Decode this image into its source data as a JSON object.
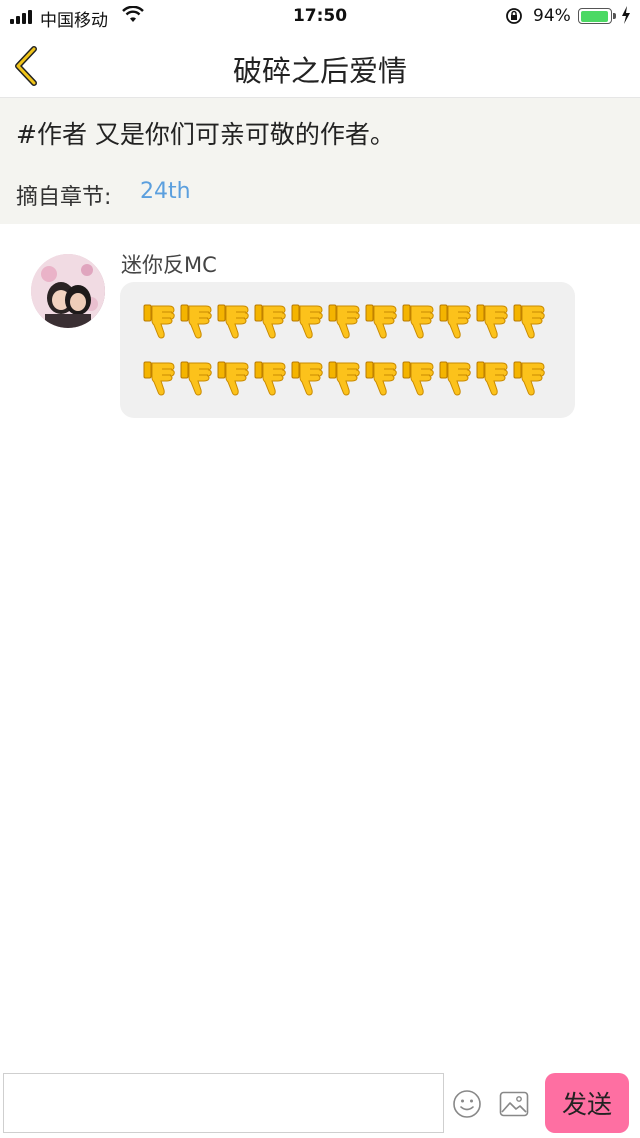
{
  "status_bar": {
    "carrier": "中国移动",
    "time": "17:50",
    "battery_percent": "94%",
    "battery_level": 0.94,
    "signal_bars": 4
  },
  "nav": {
    "title": "破碎之后爱情",
    "back_icon": "chevron-left-icon",
    "accent_color": "#f0c419"
  },
  "quote": {
    "text": "#作者 又是你们可亲可敬的作者。",
    "chapter_label": "摘自章节:",
    "chapter_value": "24th"
  },
  "comments": [
    {
      "username": "迷你反MC",
      "avatar_icon": "user-avatar",
      "emoji": "thumbs-down-icon",
      "emoji_rows": 2,
      "emoji_per_row": 11
    }
  ],
  "input_bar": {
    "placeholder": "",
    "emoji_icon": "smiley-icon",
    "image_icon": "image-icon",
    "send_label": "发送",
    "send_color": "#fe6fa2"
  }
}
